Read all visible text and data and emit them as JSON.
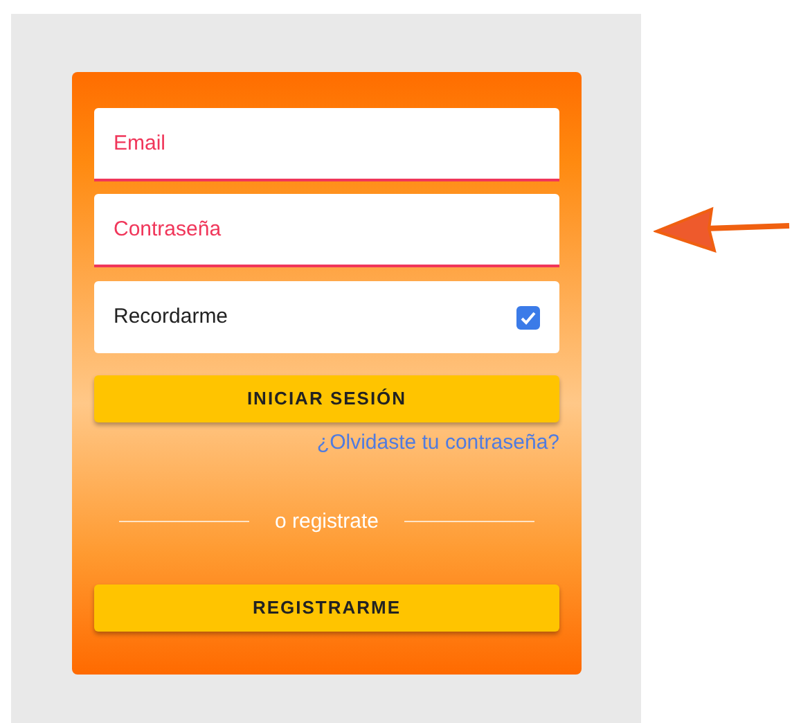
{
  "login_form": {
    "email": {
      "placeholder": "Email"
    },
    "password": {
      "placeholder": "Contraseña"
    },
    "remember": {
      "label": "Recordarme",
      "checked": true
    },
    "login_button": "INICIAR SESIÓN",
    "forgot_link": "¿Olvidaste tu contraseña?",
    "divider_text": "o registrate",
    "register_button": "REGISTRARME"
  }
}
